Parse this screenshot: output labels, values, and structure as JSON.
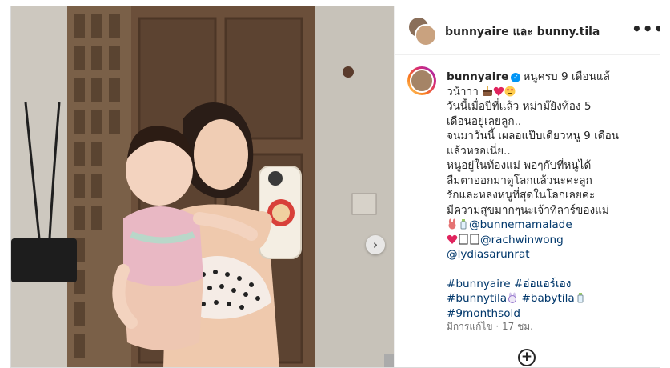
{
  "post": {
    "owner_line": "bunnyaire และ bunny.tila",
    "more_icon": "•••"
  },
  "caption": {
    "username": "bunnyaire",
    "lines": [
      "หนูครบ 9 เดือนแล้",
      "วน้าาา",
      "วันนี้เมื่อปีที่แล้ว หม่าม๊ยังท้อง 5",
      "เดือนอยู่เลยลูก..",
      "จนมาวันนี้ เผลอแป๊บเดียวหนู 9 เดือน",
      "แล้วหรอเนี่ย..",
      "หนูอยู่ในท้องแม่ พอๆกับที่หนูได้",
      "ลืมตาออกมาดูโลกแล้วนะคะลูก",
      "รักและหลงหนูที่สุดในโลกเลยค่ะ",
      "มีความสุขมากๆนะเจ้าทิลาร์ของแม่"
    ],
    "mentions": [
      "@bunnemamalade",
      "@rachwinwong",
      "@lydiasarunrat"
    ],
    "hashtags": [
      "#bunnyaire",
      "#อ่อแอร์เอง",
      "#bunnytila",
      "#babytila",
      "#9monthsold"
    ],
    "meta": "มีการแก้ไข · 17 ชม."
  },
  "colors": {
    "link": "#00376b",
    "verified": "#0095f6",
    "text": "#262626",
    "muted": "#737373"
  },
  "icons": {
    "next": "chevron-right-icon",
    "add": "plus-circle-icon",
    "more": "more-horizontal-icon"
  }
}
